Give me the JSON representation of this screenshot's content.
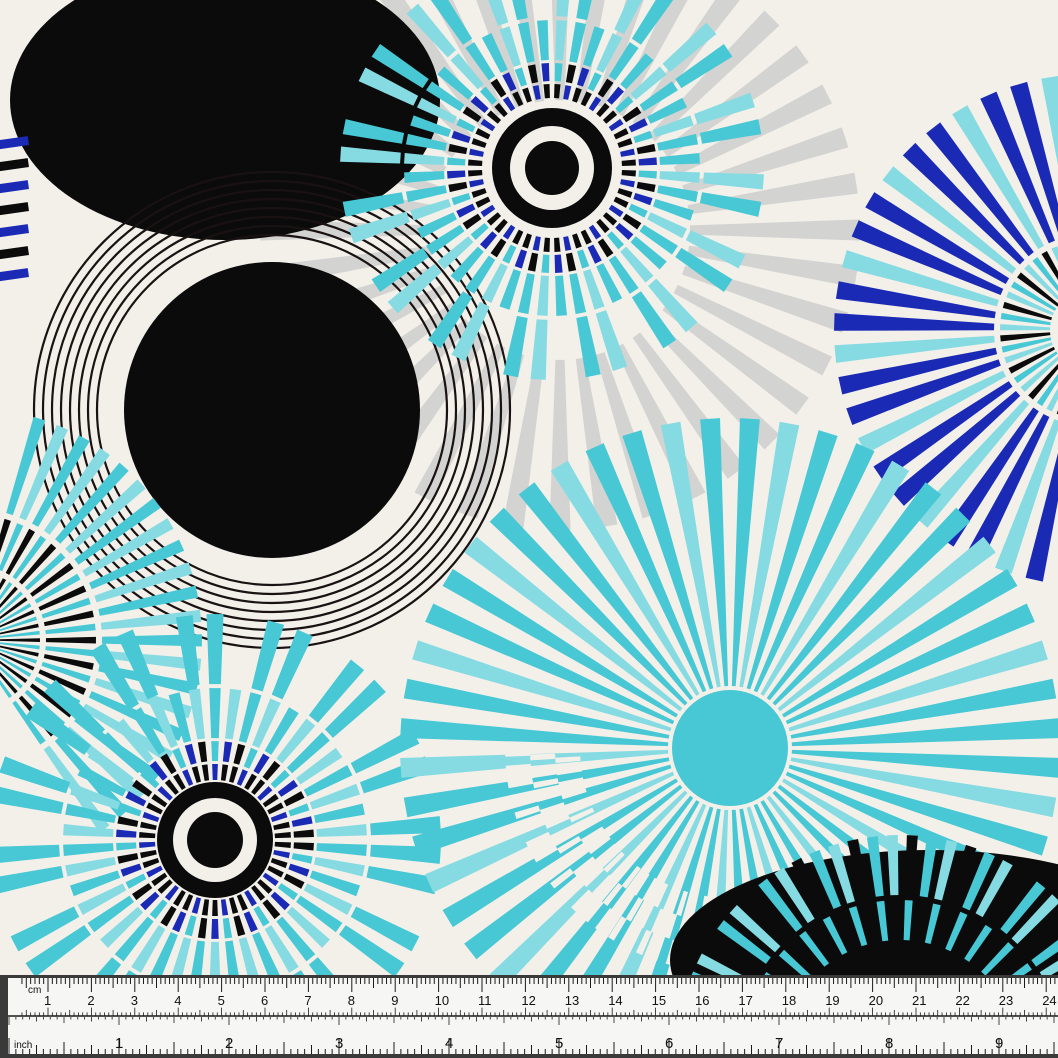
{
  "fabric": {
    "colors": {
      "background": "#f3f0ea",
      "black": "#0b0b0b",
      "turquoise": "#48c8d4",
      "royal_blue": "#1b2ab5",
      "light_turquoise": "#86dbe2"
    }
  },
  "ruler": {
    "cm_unit_label": "cm",
    "cm_labels": [
      "1",
      "2",
      "3",
      "4",
      "5",
      "6",
      "7",
      "8",
      "9",
      "10",
      "11",
      "12",
      "13",
      "14",
      "15",
      "16",
      "17",
      "18",
      "19",
      "20",
      "21",
      "22",
      "23",
      "24"
    ],
    "inch_unit_label": "inch",
    "inch_labels": [
      "1",
      "2",
      "3",
      "4",
      "5",
      "6",
      "7",
      "8",
      "9"
    ],
    "colors": {
      "paper": "#f6f6f4",
      "ink": "#1a1a1a",
      "frame": "#3a3a3a"
    }
  }
}
